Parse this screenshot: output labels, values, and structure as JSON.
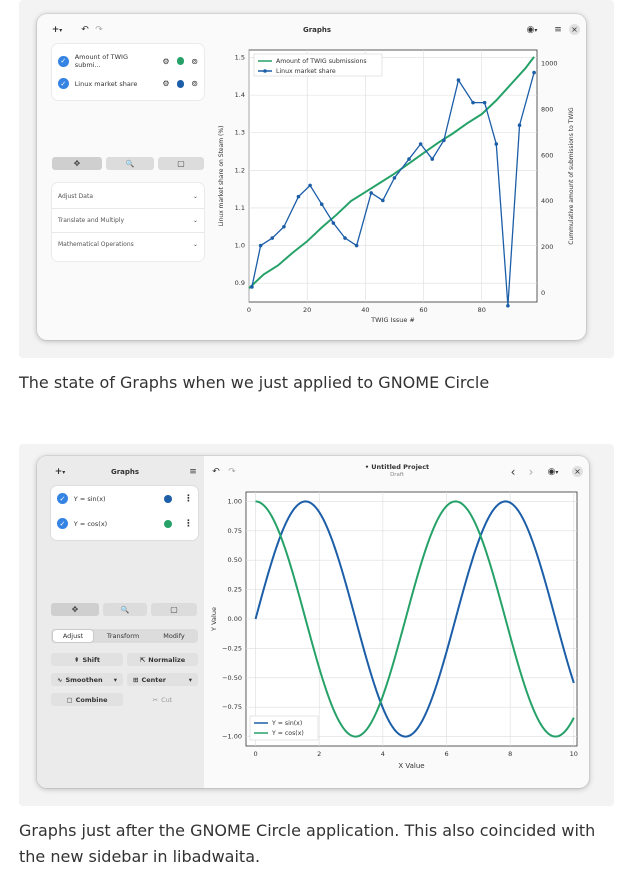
{
  "screenshot1": {
    "window_title": "Graphs",
    "header": {
      "add_label": "+",
      "add_caret": "▾",
      "undo": "↶",
      "redo": "↷",
      "view_icon": "◉",
      "view_caret": "▾",
      "menu_icon": "≡",
      "close_icon": "×"
    },
    "items": [
      {
        "label": "Amount of TWIG submi...",
        "color": "#26a269"
      },
      {
        "label": "Linux market share",
        "color": "#1c5ea8"
      }
    ],
    "tools": {
      "pan": "✥",
      "zoom": "🔍",
      "select": "▢"
    },
    "expanders": [
      "Adjust Data",
      "Translate and Multiply",
      "Mathematical Operations"
    ],
    "expander_arrow": "⌄",
    "chart_data": {
      "type": "line",
      "xlabel": "TWIG Issue #",
      "ylabel": "Linux market share on Steam (%)",
      "y2label": "Cummulative amount of submissions to TWIG",
      "xlim": [
        0,
        99
      ],
      "ylim": [
        0.85,
        1.52
      ],
      "y2lim": [
        -40,
        1060
      ],
      "xticks": [
        "0",
        "20",
        "40",
        "60",
        "80"
      ],
      "yticks": [
        "0.9",
        "1.0",
        "1.1",
        "1.2",
        "1.3",
        "1.4",
        "1.5"
      ],
      "y2ticks": [
        "0",
        "200",
        "400",
        "600",
        "800",
        "1000"
      ],
      "legend_position": "top-left",
      "series": [
        {
          "name": "Amount of TWIG submissions",
          "color": "#26a269",
          "axis": "right",
          "x": [
            0,
            5,
            10,
            15,
            20,
            25,
            30,
            35,
            40,
            45,
            50,
            55,
            60,
            65,
            70,
            75,
            80,
            85,
            90,
            95,
            98
          ],
          "y": [
            20,
            80,
            120,
            175,
            225,
            285,
            340,
            400,
            440,
            480,
            520,
            565,
            610,
            655,
            695,
            740,
            780,
            840,
            910,
            980,
            1030
          ]
        },
        {
          "name": "Linux market share",
          "color": "#1c5ea8",
          "axis": "left",
          "markers": true,
          "x": [
            1,
            4,
            8,
            12,
            17,
            21,
            25,
            29,
            33,
            37,
            42,
            46,
            50,
            55,
            59,
            63,
            67,
            72,
            77,
            81,
            85,
            89,
            93,
            98
          ],
          "y": [
            0.89,
            1.0,
            1.02,
            1.05,
            1.13,
            1.16,
            1.11,
            1.06,
            1.02,
            1.0,
            1.14,
            1.12,
            1.18,
            1.23,
            1.27,
            1.23,
            1.28,
            1.44,
            1.38,
            1.38,
            1.27,
            0.84,
            1.32,
            1.46
          ]
        }
      ]
    }
  },
  "caption1": "The state of Graphs when we just applied to GNOME Circle",
  "screenshot2": {
    "sidebar_title": "Graphs",
    "project_title": "• Untitled Project",
    "project_subtitle": "Draft",
    "header": {
      "add_label": "+",
      "add_caret": "▾",
      "menu_icon": "≡",
      "undo": "↶",
      "redo": "↷",
      "prev": "‹",
      "next": "›",
      "view_icon": "◉",
      "view_caret": "▾",
      "close_icon": "×"
    },
    "items": [
      {
        "label": "Y = sin(x)",
        "color": "#1c5ea8"
      },
      {
        "label": "Y = cos(x)",
        "color": "#26a269"
      }
    ],
    "kebab": "⋮",
    "tools": {
      "pan": "✥",
      "zoom": "🔍",
      "select": "▢"
    },
    "tabs": [
      "Adjust",
      "Transform",
      "Modify"
    ],
    "actions": {
      "shift": "Shift",
      "normalize": "Normalize",
      "smoothen": "Smoothen",
      "center": "Center",
      "combine": "Combine",
      "cut": "Cut",
      "shift_icon": "⇞",
      "normalize_icon": "⇱",
      "smoothen_icon": "∿",
      "center_icon": "⊞",
      "combine_icon": "▢",
      "cut_icon": "✂",
      "caret": "▾"
    },
    "chart_data": {
      "type": "line",
      "xlabel": "X Value",
      "ylabel": "Y Value",
      "xlim": [
        -0.3,
        10.1
      ],
      "ylim": [
        -1.08,
        1.08
      ],
      "xticks": [
        "0",
        "2",
        "4",
        "6",
        "8",
        "10"
      ],
      "yticks": [
        "1.00",
        "0.75",
        "0.50",
        "0.25",
        "0.00",
        "−0.25",
        "−0.50",
        "−0.75",
        "−1.00"
      ],
      "legend_position": "bottom-left",
      "series": [
        {
          "name": "Y = sin(x)",
          "color": "#1c5ea8",
          "function": "sin",
          "x_range": [
            0,
            10
          ]
        },
        {
          "name": "Y = cos(x)",
          "color": "#26a269",
          "function": "cos",
          "x_range": [
            0,
            10
          ]
        }
      ]
    }
  },
  "caption2": "Graphs just after the GNOME Circle application. This also coincided with the new sidebar in libadwaita."
}
